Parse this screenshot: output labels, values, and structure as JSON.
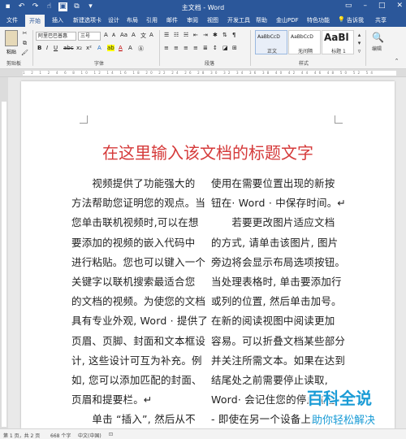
{
  "titlebar": {
    "document_title": "主文档 - Word",
    "quick_access": [
      "save-icon",
      "undo-icon",
      "redo-icon",
      "touch-mode-icon",
      "pointer-icon",
      "format-icon",
      "more-icon"
    ],
    "window_controls": [
      "restore-ribbon-icon",
      "minimize-icon",
      "maximize-icon",
      "close-icon"
    ]
  },
  "tabs": [
    {
      "label": "文件"
    },
    {
      "label": "开始",
      "active": true
    },
    {
      "label": "插入"
    },
    {
      "label": "新建选项卡"
    },
    {
      "label": "设计"
    },
    {
      "label": "布局"
    },
    {
      "label": "引用"
    },
    {
      "label": "邮件"
    },
    {
      "label": "审阅"
    },
    {
      "label": "视图"
    },
    {
      "label": "开发工具"
    },
    {
      "label": "帮助"
    },
    {
      "label": "金山PDF"
    },
    {
      "label": "特色功能"
    }
  ],
  "tab_right": {
    "tell_me": "告诉我",
    "share": "共享"
  },
  "ribbon": {
    "clipboard": {
      "paste": "粘贴",
      "group": "剪贴板"
    },
    "font": {
      "family": "阿里巴巴普惠",
      "size": "三号",
      "group": "字体",
      "increase": "A",
      "decrease": "A",
      "clear": "A",
      "wen": "文",
      "phonetic": "A"
    },
    "paragraph": {
      "group": "段落"
    },
    "styles": {
      "group": "样式",
      "items": [
        {
          "sample": "AaBbCcD",
          "name": "正文"
        },
        {
          "sample": "AaBbCcD",
          "name": "无间隔"
        },
        {
          "sample": "AaBl",
          "name": "标题 1"
        }
      ]
    },
    "editing": {
      "group": "编辑"
    }
  },
  "ruler": {
    "ticks": "1 2 1 2 4 6 8 10 12 14 16 18 20 22 24 26 28 30 32 34 36 38 40 42 44 46 48 50 52 54"
  },
  "document": {
    "heading": "在这里输入该文档的标题文字",
    "left_col": [
      "　　视频提供了功能强大的",
      "方法帮助您证明您的观点。当",
      "您单击联机视频时,可以在想",
      "要添加的视频的嵌入代码中",
      "进行粘贴。您也可以键入一个",
      "关键字以联机搜索最适合您",
      "的文档的视频。为使您的文档",
      "具有专业外观, Word · 提供了",
      "页眉、页脚、封面和文本框设",
      "计, 这些设计可互为补充。例",
      "如, 您可以添加匹配的封面、",
      "页眉和提要栏。↵",
      "　　单击 “插入”, 然后从不"
    ],
    "right_col": [
      "使用在需要位置出现的新按",
      "钮在· Word · 中保存时间。↵",
      "　　若要更改图片适应文档",
      "的方式, 请单击该图片, 图片",
      "旁边将会显示布局选项按钮。",
      "当处理表格时, 单击要添加行",
      "或列的位置, 然后单击加号。",
      "在新的阅读视图中阅读更加",
      "容易。可以折叠文档某些部分",
      "并关注所需文本。如果在达到",
      "结尾处之前需要停止读取,",
      "Word· 会记住您的停止位置",
      "- 即使在另一个设备上。"
    ]
  },
  "status": {
    "page": "第 1 页，共 2 页",
    "words": "668 个字",
    "lang": "中文(中国)"
  },
  "watermark": {
    "title": "百科全说",
    "subtitle": "助你轻松解决"
  }
}
